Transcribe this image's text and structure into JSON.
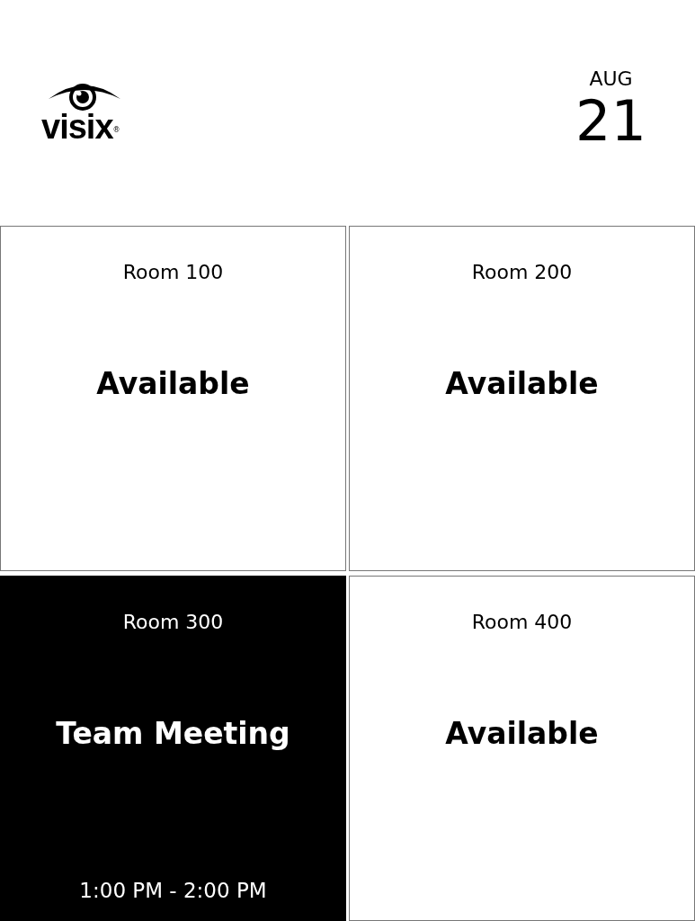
{
  "logo": {
    "wordmark": "visix",
    "mark": "®"
  },
  "date": {
    "month": "AUG",
    "day": "21"
  },
  "rooms": [
    {
      "name": "Room 100",
      "status": "Available",
      "occupied": false
    },
    {
      "name": "Room 200",
      "status": "Available",
      "occupied": false
    },
    {
      "name": "Room 300",
      "status": "Team Meeting",
      "occupied": true,
      "time": "1:00 PM - 2:00 PM"
    },
    {
      "name": "Room 400",
      "status": "Available",
      "occupied": false
    }
  ]
}
